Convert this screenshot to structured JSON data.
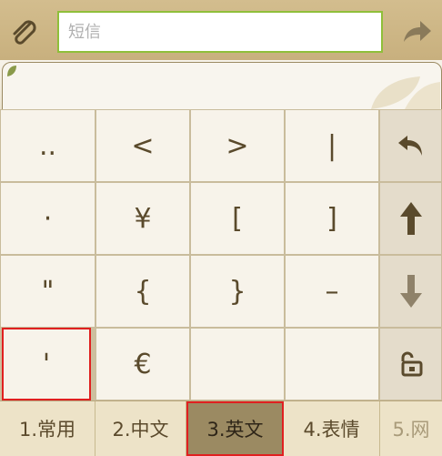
{
  "compose": {
    "placeholder": "短信"
  },
  "keyboard": {
    "rows": [
      [
        "..",
        "<",
        ">",
        "|"
      ],
      [
        "·",
        "¥",
        "[",
        "]"
      ],
      [
        "\"",
        "{",
        "}",
        "–"
      ],
      [
        "'",
        "€",
        "",
        ""
      ]
    ]
  },
  "tabs": [
    {
      "label": "1.常用"
    },
    {
      "label": "2.中文"
    },
    {
      "label": "3.英文"
    },
    {
      "label": "4.表情"
    },
    {
      "label": "5.网"
    }
  ],
  "colors": {
    "accent_border": "#8fbf3a",
    "highlight": "#e02020",
    "active_tab": "#9b8a62"
  }
}
